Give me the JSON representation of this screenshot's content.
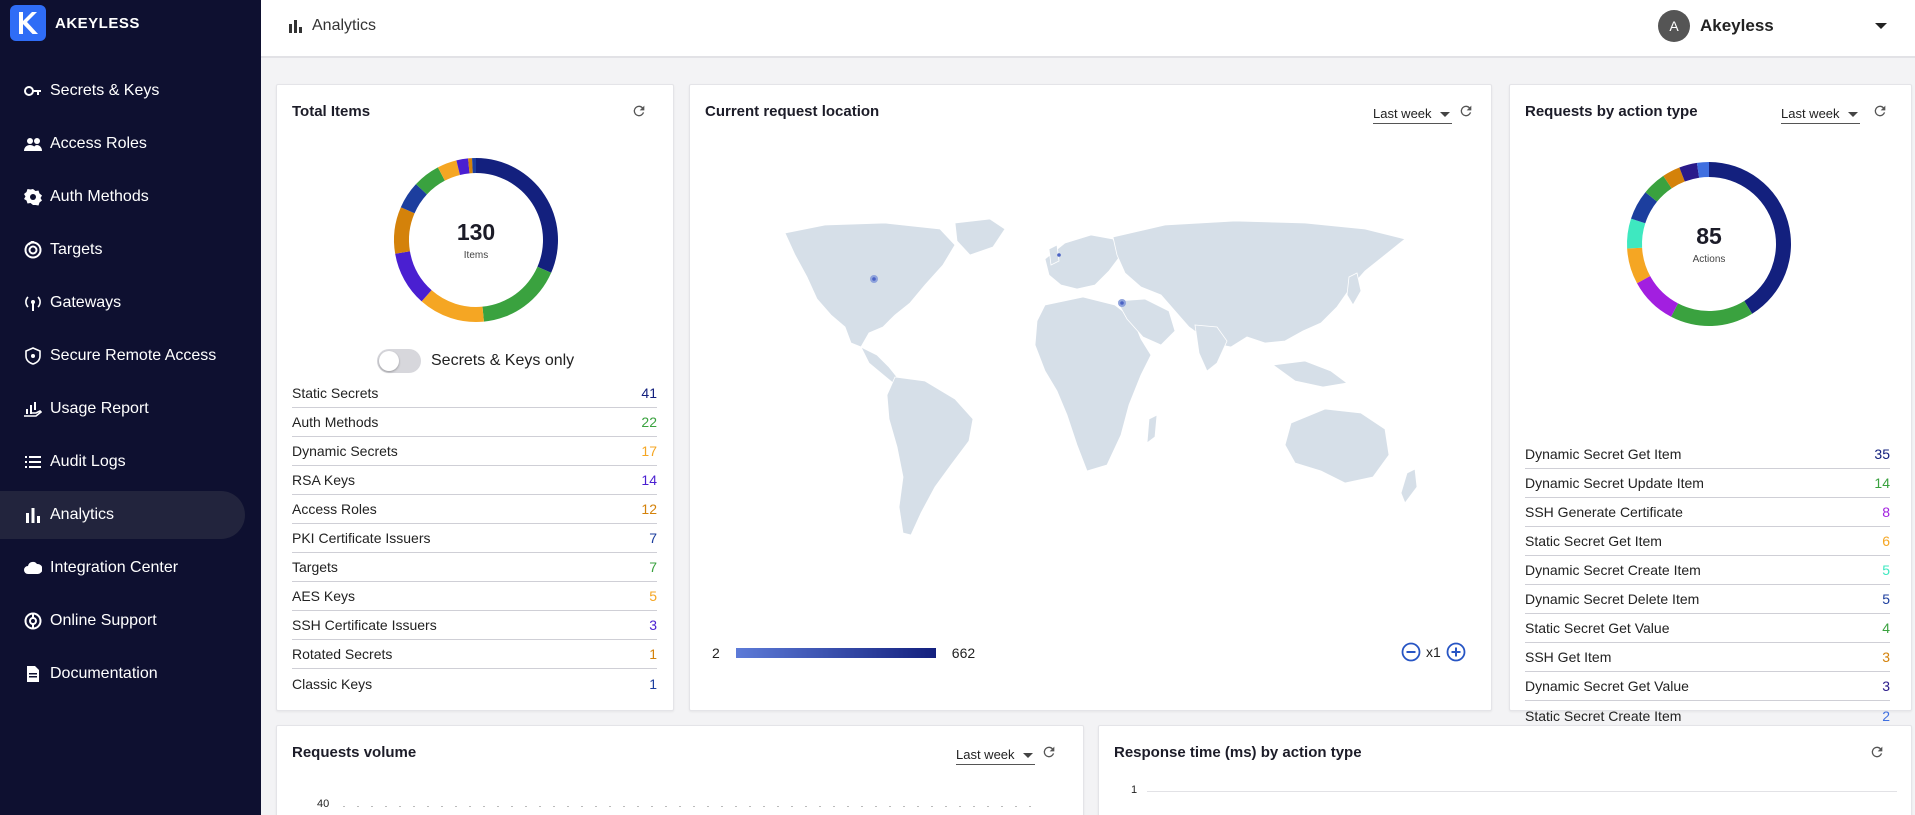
{
  "brand": {
    "name": "AKEYLESS",
    "logo_letter": "K"
  },
  "nav": [
    {
      "label": "Secrets & Keys",
      "icon": "key-icon"
    },
    {
      "label": "Access Roles",
      "icon": "people-icon"
    },
    {
      "label": "Auth Methods",
      "icon": "badge-icon"
    },
    {
      "label": "Targets",
      "icon": "target-icon"
    },
    {
      "label": "Gateways",
      "icon": "antenna-icon"
    },
    {
      "label": "Secure Remote Access",
      "icon": "shield-icon"
    },
    {
      "label": "Usage Report",
      "icon": "chart-hand-icon"
    },
    {
      "label": "Audit Logs",
      "icon": "list-icon"
    },
    {
      "label": "Analytics",
      "icon": "bar-chart-icon",
      "active": true
    },
    {
      "label": "Integration Center",
      "icon": "cloud-icon"
    },
    {
      "label": "Online Support",
      "icon": "support-icon"
    },
    {
      "label": "Documentation",
      "icon": "document-icon"
    }
  ],
  "header": {
    "title": "Analytics",
    "user_initial": "A",
    "user_name": "Akeyless"
  },
  "total_items": {
    "title": "Total Items",
    "total": "130",
    "total_label": "Items",
    "toggle_label": "Secrets & Keys only",
    "toggle_on": false,
    "rows": [
      {
        "label": "Static Secrets",
        "value": "41",
        "color": "#13207e"
      },
      {
        "label": "Auth Methods",
        "value": "22",
        "color": "#3aa23f"
      },
      {
        "label": "Dynamic Secrets",
        "value": "17",
        "color": "#f5a623"
      },
      {
        "label": "RSA Keys",
        "value": "14",
        "color": "#4a1fd1"
      },
      {
        "label": "Access Roles",
        "value": "12",
        "color": "#d4820a"
      },
      {
        "label": "PKI Certificate Issuers",
        "value": "7",
        "color": "#1c3e9e"
      },
      {
        "label": "Targets",
        "value": "7",
        "color": "#3aa23f"
      },
      {
        "label": "AES Keys",
        "value": "5",
        "color": "#f5a623"
      },
      {
        "label": "SSH Certificate Issuers",
        "value": "3",
        "color": "#4a1fd1"
      },
      {
        "label": "Rotated Secrets",
        "value": "1",
        "color": "#d4820a"
      },
      {
        "label": "Classic Keys",
        "value": "1",
        "color": "#1c3e9e"
      }
    ]
  },
  "location": {
    "title": "Current request location",
    "range": "Last week",
    "legend_min": "2",
    "legend_max": "662",
    "zoom_level": "x1"
  },
  "action_type": {
    "title": "Requests by action type",
    "range": "Last week",
    "total": "85",
    "total_label": "Actions",
    "rows": [
      {
        "label": "Dynamic Secret Get Item",
        "value": "35",
        "color": "#13207e"
      },
      {
        "label": "Dynamic Secret Update Item",
        "value": "14",
        "color": "#3aa23f"
      },
      {
        "label": "SSH Generate Certificate",
        "value": "8",
        "color": "#a21fe0"
      },
      {
        "label": "Static Secret Get Item",
        "value": "6",
        "color": "#f5a623"
      },
      {
        "label": "Dynamic Secret Create Item",
        "value": "5",
        "color": "#3ee8c0"
      },
      {
        "label": "Dynamic Secret Delete Item",
        "value": "5",
        "color": "#1c3e9e"
      },
      {
        "label": "Static Secret Get Value",
        "value": "4",
        "color": "#3aa23f"
      },
      {
        "label": "SSH Get Item",
        "value": "3",
        "color": "#d4820a"
      },
      {
        "label": "Dynamic Secret Get Value",
        "value": "3",
        "color": "#2a1a8a"
      },
      {
        "label": "Static Secret Create Item",
        "value": "2",
        "color": "#3f6fe0"
      }
    ]
  },
  "volume": {
    "title": "Requests volume",
    "range": "Last week",
    "y_tick_top": "40"
  },
  "response": {
    "title": "Response time (ms) by action type",
    "y_tick_top": "1"
  }
}
